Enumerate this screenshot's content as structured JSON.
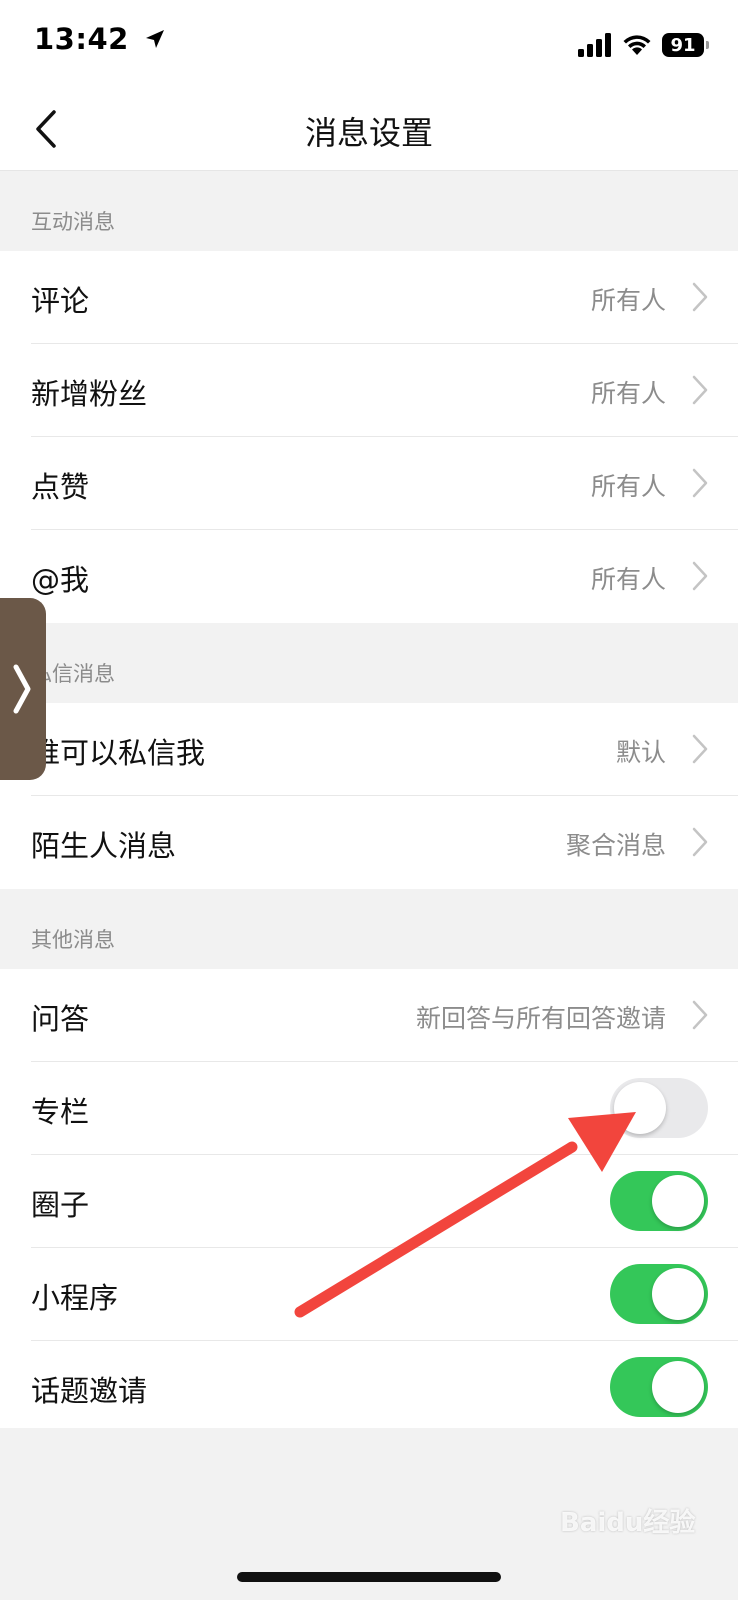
{
  "status_bar": {
    "time": "13:42",
    "battery": "91",
    "icons": [
      "location-arrow-icon",
      "signal-icon",
      "wifi-icon",
      "battery-icon"
    ]
  },
  "nav": {
    "title": "消息设置",
    "back_icon": "chevron-left-icon"
  },
  "sections": {
    "interaction": {
      "header": "互动消息",
      "rows": [
        {
          "label": "评论",
          "value": "所有人"
        },
        {
          "label": "新增粉丝",
          "value": "所有人"
        },
        {
          "label": "点赞",
          "value": "所有人"
        },
        {
          "label": "@我",
          "value": "所有人"
        }
      ]
    },
    "private": {
      "header": "私信消息",
      "rows": [
        {
          "label": "谁可以私信我",
          "value": "默认"
        },
        {
          "label": "陌生人消息",
          "value": "聚合消息"
        }
      ]
    },
    "other": {
      "header": "其他消息",
      "rows": [
        {
          "label": "问答",
          "value": "新回答与所有回答邀请"
        },
        {
          "label": "专栏",
          "toggle": false
        },
        {
          "label": "圈子",
          "toggle": true
        },
        {
          "label": "小程序",
          "toggle": true
        },
        {
          "label": "话题邀请",
          "toggle": true
        }
      ]
    }
  },
  "colors": {
    "toggle_on": "#34c759",
    "toggle_off": "#e9e9eb",
    "annotation_arrow": "#f2453d",
    "side_handle": "#6b5848"
  },
  "watermark": "Baidu经验"
}
